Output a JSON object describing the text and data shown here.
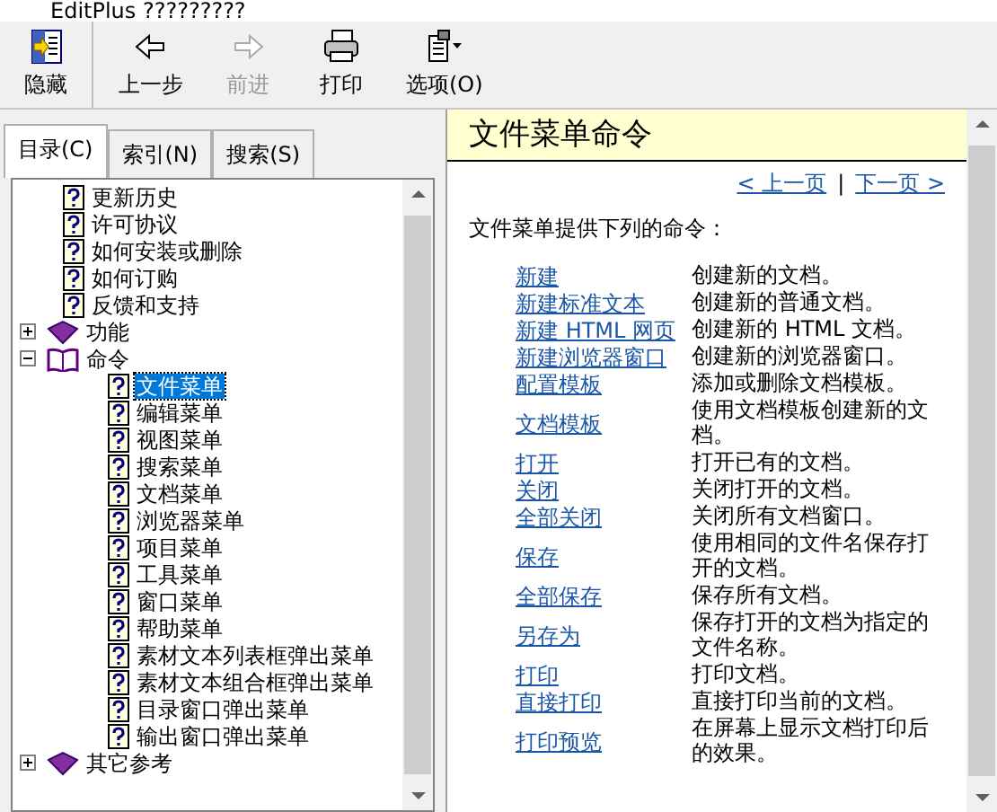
{
  "window": {
    "title": "EditPlus ?????????"
  },
  "toolbar": [
    {
      "label": "隐藏",
      "disabled": false
    },
    {
      "label": "上一步",
      "disabled": false
    },
    {
      "label": "前进",
      "disabled": true
    },
    {
      "label": "打印",
      "disabled": false
    },
    {
      "label": "选项(O)",
      "disabled": false
    }
  ],
  "tabs": [
    {
      "label": "目录(C)",
      "selected": true
    },
    {
      "label": "索引(N)",
      "selected": false
    },
    {
      "label": "搜索(S)",
      "selected": false
    }
  ],
  "tree": [
    {
      "label": "更新历史",
      "kind": "page",
      "selected": false
    },
    {
      "label": "许可协议",
      "kind": "page",
      "selected": false
    },
    {
      "label": "如何安装或删除",
      "kind": "page",
      "selected": false
    },
    {
      "label": "如何订购",
      "kind": "page",
      "selected": false
    },
    {
      "label": "反馈和支持",
      "kind": "page",
      "selected": false
    },
    {
      "label": "功能",
      "kind": "book",
      "expanded": false,
      "selected": false
    },
    {
      "label": "命令",
      "kind": "book",
      "expanded": true,
      "selected": false,
      "children": [
        {
          "label": "文件菜单",
          "kind": "page",
          "selected": true
        },
        {
          "label": "编辑菜单",
          "kind": "page",
          "selected": false
        },
        {
          "label": "视图菜单",
          "kind": "page",
          "selected": false
        },
        {
          "label": "搜索菜单",
          "kind": "page",
          "selected": false
        },
        {
          "label": "文档菜单",
          "kind": "page",
          "selected": false
        },
        {
          "label": "浏览器菜单",
          "kind": "page",
          "selected": false
        },
        {
          "label": "项目菜单",
          "kind": "page",
          "selected": false
        },
        {
          "label": "工具菜单",
          "kind": "page",
          "selected": false
        },
        {
          "label": "窗口菜单",
          "kind": "page",
          "selected": false
        },
        {
          "label": "帮助菜单",
          "kind": "page",
          "selected": false
        },
        {
          "label": "素材文本列表框弹出菜单",
          "kind": "page",
          "selected": false
        },
        {
          "label": "素材文本组合框弹出菜单",
          "kind": "page",
          "selected": false
        },
        {
          "label": "目录窗口弹出菜单",
          "kind": "page",
          "selected": false
        },
        {
          "label": "输出窗口弹出菜单",
          "kind": "page",
          "selected": false
        }
      ]
    },
    {
      "label": "其它参考",
      "kind": "book",
      "expanded": false,
      "selected": false
    }
  ],
  "page": {
    "heading": "文件菜单命令",
    "prev_link": "< 上一页",
    "separator": "|",
    "next_link": "下一页 >",
    "intro": "文件菜单提供下列的命令：",
    "commands": [
      {
        "name": "新建",
        "description": "创建新的文档。"
      },
      {
        "name": "新建标准文本",
        "description": "创建新的普通文档。"
      },
      {
        "name": "新建 HTML 网页",
        "description": "创建新的 HTML 文档。"
      },
      {
        "name": "新建浏览器窗口",
        "description": "创建新的浏览器窗口。"
      },
      {
        "name": "配置模板",
        "description": "添加或删除文档模板。"
      },
      {
        "name": "文档模板",
        "description": "使用文档模板创建新的文档。"
      },
      {
        "name": "打开",
        "description": "打开已有的文档。"
      },
      {
        "name": "关闭",
        "description": "关闭打开的文档。"
      },
      {
        "name": "全部关闭",
        "description": "关闭所有文档窗口。"
      },
      {
        "name": "保存",
        "description": "使用相同的文件名保存打开的文档。"
      },
      {
        "name": "全部保存",
        "description": "保存所有文档。"
      },
      {
        "name": "另存为",
        "description": "保存打开的文档为指定的文件名称。"
      },
      {
        "name": "打印",
        "description": "打印文档。"
      },
      {
        "name": "直接打印",
        "description": "直接打印当前的文档。"
      },
      {
        "name": "打印预览",
        "description": "在屏幕上显示文档打印后的效果。"
      }
    ]
  }
}
